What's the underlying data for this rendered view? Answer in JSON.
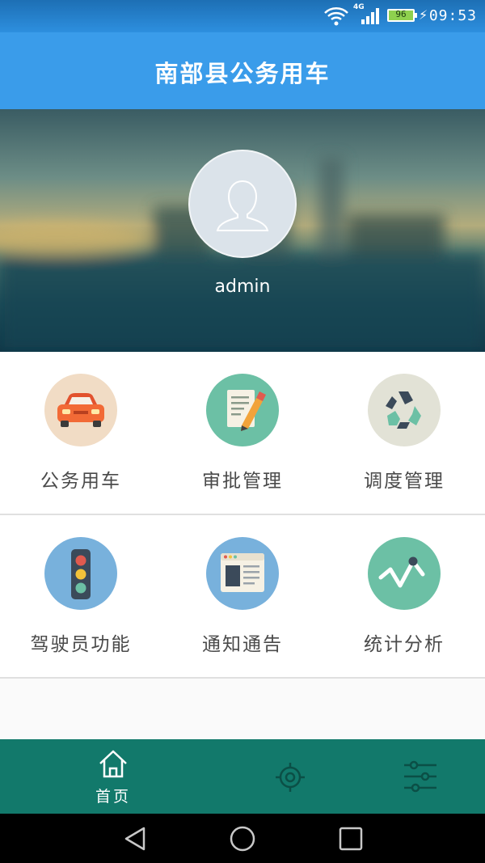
{
  "status_bar": {
    "network": "4G",
    "battery": "96",
    "time": "09:53"
  },
  "app_bar": {
    "title": "南部县公务用车"
  },
  "profile": {
    "username": "admin"
  },
  "menu": [
    {
      "label": "公务用车",
      "icon": "car-icon",
      "color": "#f1dcc5"
    },
    {
      "label": "审批管理",
      "icon": "approval-pencil-icon",
      "color": "#6cc0a5"
    },
    {
      "label": "调度管理",
      "icon": "dispatch-recycle-icon",
      "color": "#e2e2d6"
    },
    {
      "label": "驾驶员功能",
      "icon": "traffic-light-icon",
      "color": "#78b1dc"
    },
    {
      "label": "通知通告",
      "icon": "notice-window-icon",
      "color": "#78b1dc"
    },
    {
      "label": "统计分析",
      "icon": "statistics-chart-icon",
      "color": "#6cc0a5"
    }
  ],
  "tab_bar": {
    "home_label": "首页"
  }
}
